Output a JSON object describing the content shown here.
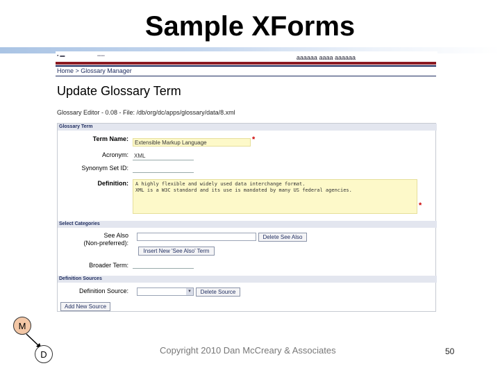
{
  "slide": {
    "title": "Sample XForms",
    "copyright": "Copyright 2010 Dan McCreary & Associates",
    "page_number": "50",
    "node_m": "M",
    "node_d": "D",
    "colors": {
      "title_rule": "#aac4e4",
      "node_m_fill": "#f3c7a6"
    }
  },
  "screenshot": {
    "logo_text": "▪ ▬",
    "logo_subtext": "▪▪▪▪▪",
    "top_right_text": "aaaaaa aaaa aaaaaa",
    "breadcrumb": "Home > Glossary Manager",
    "page_heading": "Update Glossary Term",
    "editor_line": "Glossary Editor - 0.08 - File: /db/org/dc/apps/glossary/data/8.xml",
    "sections": {
      "glossary_term": "Glossary Term",
      "select_categories": "Select Categories",
      "definition_sources": "Definition Sources"
    },
    "fields": {
      "term_name": {
        "label": "Term Name:",
        "value": "Extensible Markup Language",
        "required": "*"
      },
      "acronym": {
        "label": "Acronym:",
        "value": "XML"
      },
      "synonym_set_id": {
        "label": "Synonym Set ID:",
        "value": ""
      },
      "definition": {
        "label": "Definition:",
        "line1": "A highly flexible and widely used data interchange format.",
        "line2": "XML is a W3C standard and its use is mandated by many US federal agencies.",
        "required": "*"
      },
      "see_also": {
        "label_line1": "See Also",
        "label_line2": "(Non-preferred):",
        "value": ""
      },
      "broader_term": {
        "label": "Broader Term:",
        "value": ""
      },
      "definition_source": {
        "label": "Definition Source:",
        "selected": ""
      }
    },
    "buttons": {
      "delete_see_also": "Delete See Also",
      "insert_new_see_also": "Insert New 'See Also' Term",
      "delete_source": "Delete Source",
      "add_new_source": "Add New Source"
    },
    "icons": {
      "select_arrow": "▾"
    }
  }
}
